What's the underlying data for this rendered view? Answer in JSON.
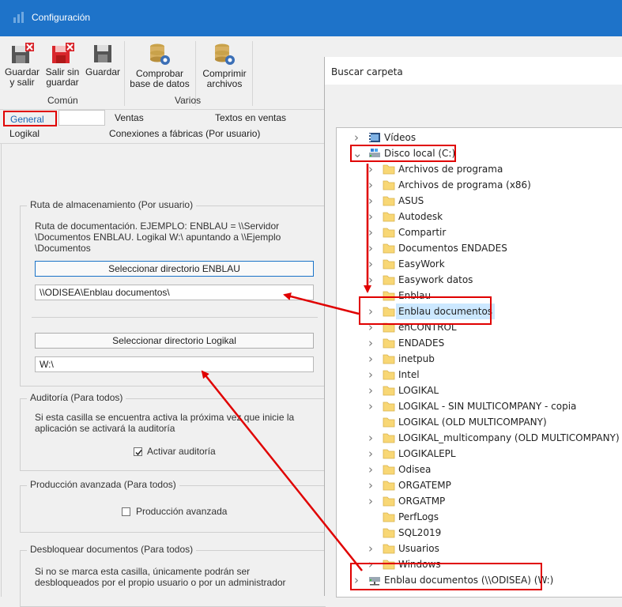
{
  "window": {
    "title": "Configuración"
  },
  "ribbon": {
    "buttons": [
      {
        "label": "Guardar\ny salir",
        "icon": "save-exit-icon"
      },
      {
        "label": "Salir sin\nguardar",
        "icon": "exit-no-save-icon"
      },
      {
        "label": "Guardar",
        "icon": "save-icon"
      },
      {
        "label": "Comprobar\nbase de datos",
        "icon": "database-check-icon"
      },
      {
        "label": "Comprimir\narchivos",
        "icon": "compress-files-icon"
      }
    ],
    "groups": {
      "comun": "Común",
      "varios": "Varios"
    }
  },
  "tabs": {
    "general": "General",
    "ventas": "Ventas",
    "textos": "Textos en ventas",
    "logikal": "Logikal",
    "conexiones": "Conexiones a fábricas (Por usuario)"
  },
  "storage": {
    "legend": "Ruta de almacenamiento (Por usuario)",
    "description_lines": [
      "Ruta de documentación. EJEMPLO: ENBLAU = \\\\Servidor",
      "\\Documentos ENBLAU. Logikal W:\\ apuntando a \\\\Ejemplo",
      "\\Documentos"
    ],
    "enblau_button": "Seleccionar directorio ENBLAU",
    "enblau_path": "\\\\ODISEA\\Enblau documentos\\",
    "logikal_button": "Seleccionar directorio Logikal",
    "logikal_path": "W:\\"
  },
  "audit": {
    "legend": "Auditoría (Para todos)",
    "description_lines": [
      "Si esta casilla se encuentra activa la próxima vez que inicie la",
      "aplicación se activará la auditoría"
    ],
    "checkbox_label": "Activar auditoría",
    "checked": true
  },
  "production": {
    "legend": "Producción avanzada (Para todos)",
    "checkbox_label": "Producción avanzada",
    "checked": false
  },
  "unlock": {
    "legend": "Desbloquear documentos (Para todos)",
    "description_lines": [
      "Si no se marca esta casilla, únicamente podrán ser",
      "desbloqueados por el propio usuario o por un administrador"
    ]
  },
  "dialog": {
    "title": "Buscar carpeta",
    "tree": [
      {
        "label": "Vídeos",
        "icon": "videos-folder-icon",
        "level": 0,
        "expander": ">"
      },
      {
        "label": "Disco local (C:)",
        "icon": "local-disk-icon",
        "level": 0,
        "expander": "v"
      },
      {
        "label": "Archivos de programa",
        "icon": "folder-icon",
        "level": 1,
        "expander": ">"
      },
      {
        "label": "Archivos de programa (x86)",
        "icon": "folder-icon",
        "level": 1,
        "expander": ">"
      },
      {
        "label": "ASUS",
        "icon": "folder-icon",
        "level": 1,
        "expander": ">"
      },
      {
        "label": "Autodesk",
        "icon": "folder-icon",
        "level": 1,
        "expander": ">"
      },
      {
        "label": "Compartir",
        "icon": "folder-icon",
        "level": 1,
        "expander": ">"
      },
      {
        "label": "Documentos ENDADES",
        "icon": "folder-icon",
        "level": 1,
        "expander": ">"
      },
      {
        "label": "EasyWork",
        "icon": "folder-icon",
        "level": 1,
        "expander": ">"
      },
      {
        "label": "Easywork datos",
        "icon": "folder-icon",
        "level": 1,
        "expander": ">"
      },
      {
        "label": "Enblau",
        "icon": "folder-icon",
        "level": 1,
        "expander": ""
      },
      {
        "label": "Enblau documentos",
        "icon": "folder-icon",
        "level": 1,
        "expander": ">",
        "selected": true
      },
      {
        "label": "enCONTROL",
        "icon": "folder-icon",
        "level": 1,
        "expander": ">"
      },
      {
        "label": "ENDADES",
        "icon": "folder-icon",
        "level": 1,
        "expander": ">"
      },
      {
        "label": "inetpub",
        "icon": "folder-icon",
        "level": 1,
        "expander": ">"
      },
      {
        "label": "Intel",
        "icon": "folder-icon",
        "level": 1,
        "expander": ">"
      },
      {
        "label": "LOGIKAL",
        "icon": "folder-icon",
        "level": 1,
        "expander": ">"
      },
      {
        "label": "LOGIKAL - SIN MULTICOMPANY - copia",
        "icon": "folder-icon",
        "level": 1,
        "expander": ">"
      },
      {
        "label": "LOGIKAL (OLD MULTICOMPANY)",
        "icon": "folder-icon",
        "level": 1,
        "expander": ""
      },
      {
        "label": "LOGIKAL_multicompany (OLD MULTICOMPANY)",
        "icon": "folder-icon",
        "level": 1,
        "expander": ">"
      },
      {
        "label": "LOGIKALEPL",
        "icon": "folder-icon",
        "level": 1,
        "expander": ">"
      },
      {
        "label": "Odisea",
        "icon": "folder-icon",
        "level": 1,
        "expander": ">"
      },
      {
        "label": "ORGATEMP",
        "icon": "folder-icon",
        "level": 1,
        "expander": ">"
      },
      {
        "label": "ORGATMP",
        "icon": "folder-icon",
        "level": 1,
        "expander": ">"
      },
      {
        "label": "PerfLogs",
        "icon": "folder-icon",
        "level": 1,
        "expander": ""
      },
      {
        "label": "SQL2019",
        "icon": "folder-icon",
        "level": 1,
        "expander": ""
      },
      {
        "label": "Usuarios",
        "icon": "folder-icon",
        "level": 1,
        "expander": ">"
      },
      {
        "label": "Windows",
        "icon": "folder-icon",
        "level": 1,
        "expander": ">"
      },
      {
        "label": "Enblau documentos (\\\\ODISEA) (W:)",
        "icon": "network-drive-icon",
        "level": 0,
        "expander": ">"
      }
    ]
  },
  "colors": {
    "titlebar": "#1e73c9",
    "annotation": "#e00000",
    "selection": "#cce8ff",
    "folder": "#f8d775"
  }
}
